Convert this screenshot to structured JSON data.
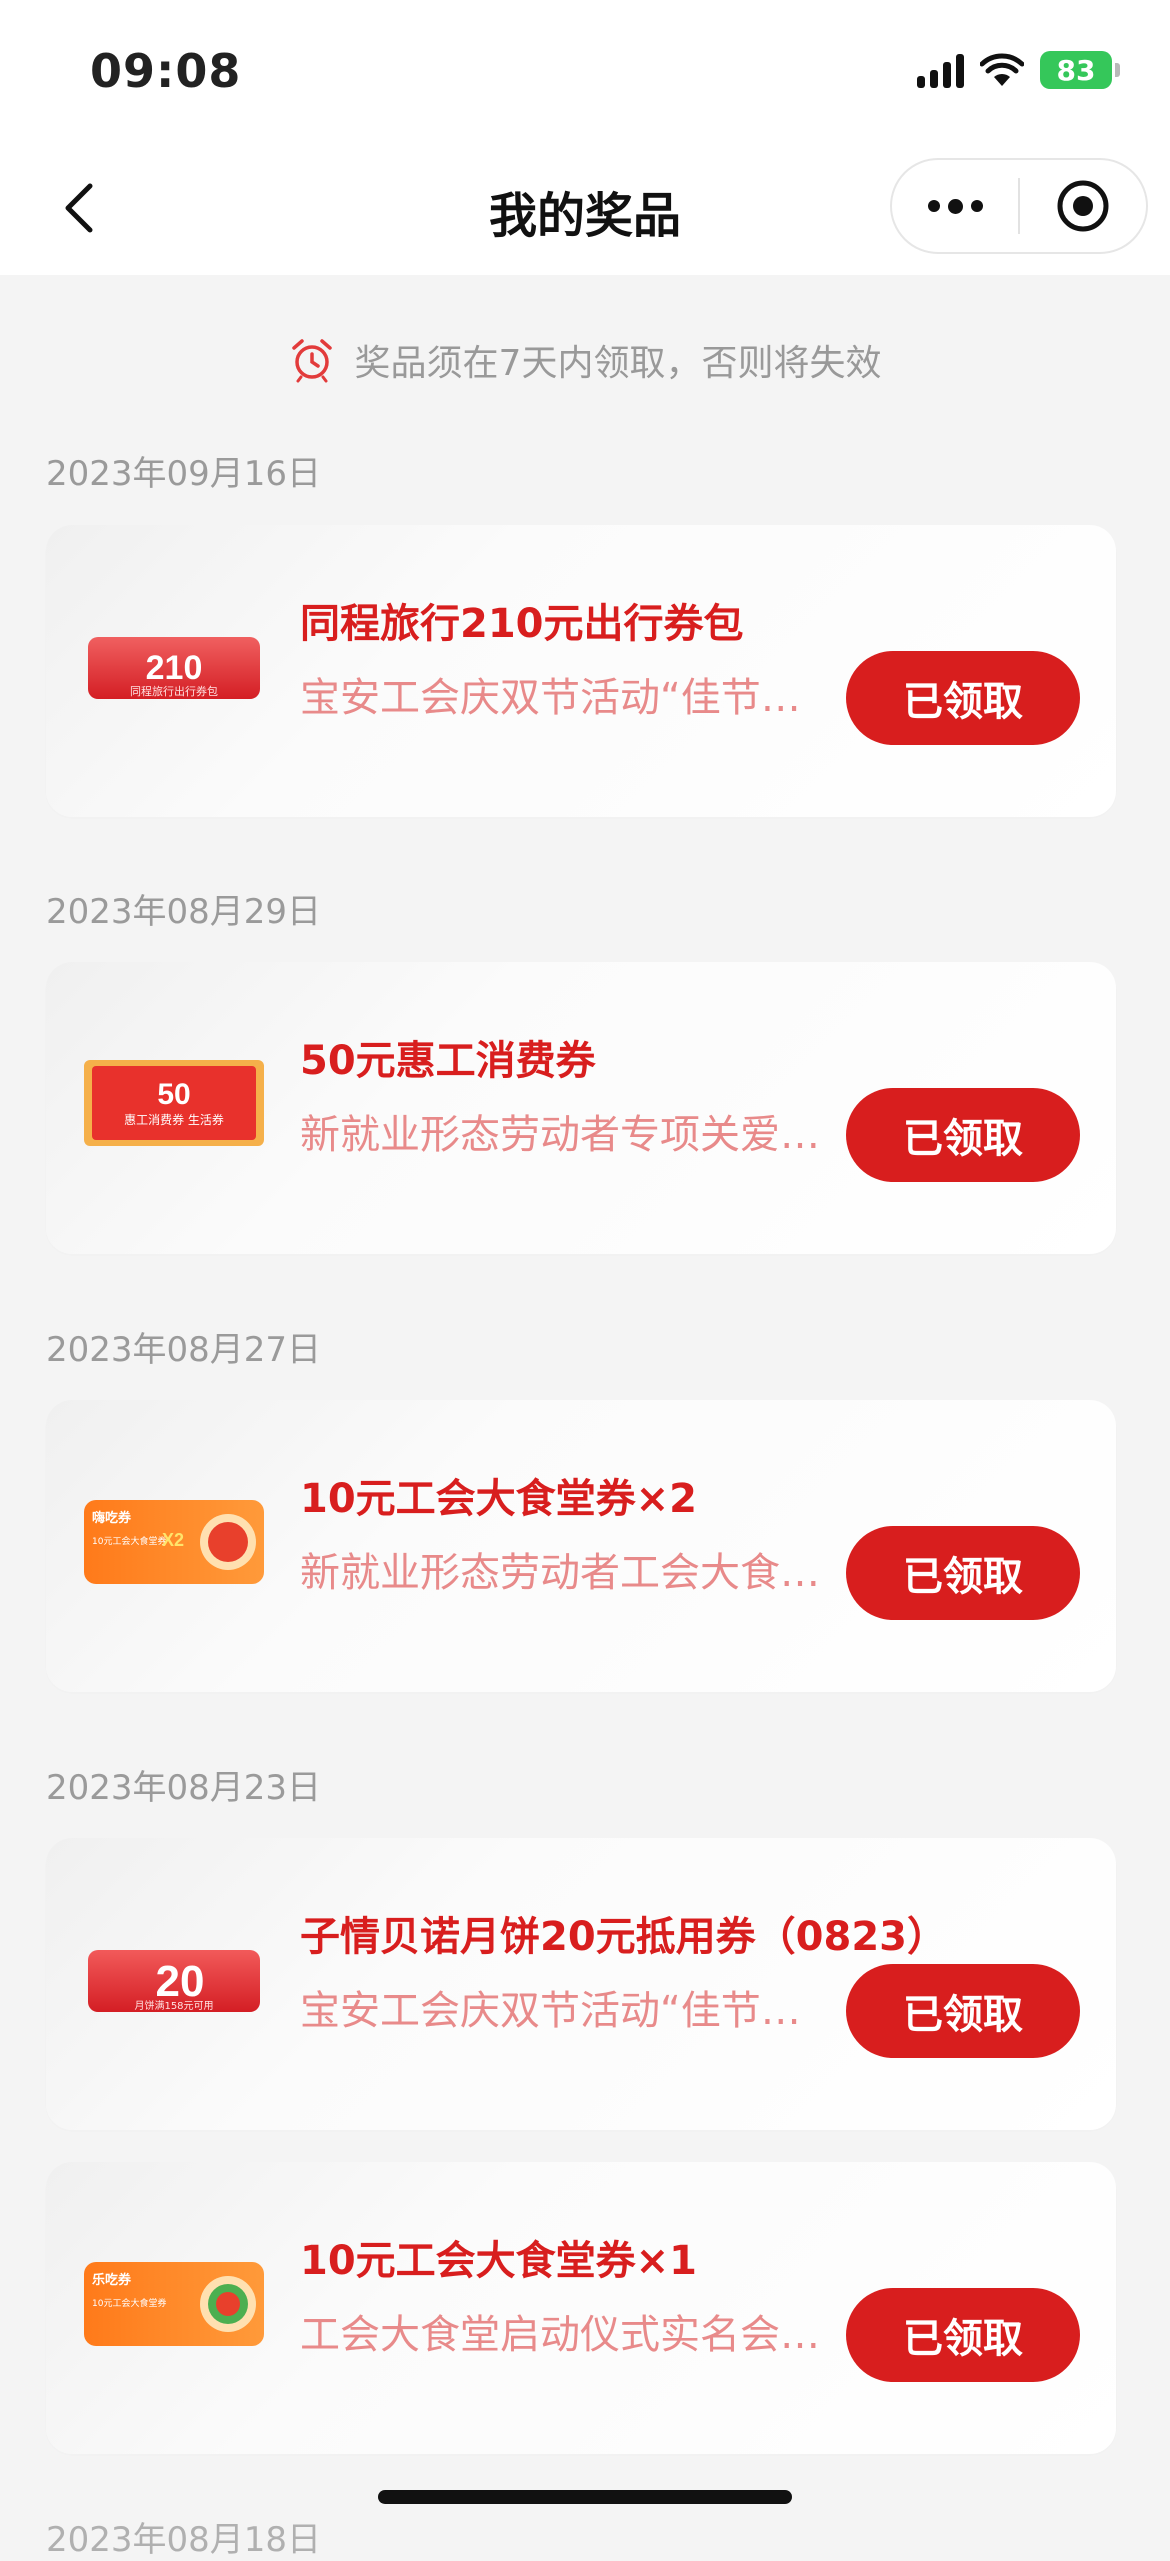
{
  "status_bar": {
    "time": "09:08",
    "battery": "83"
  },
  "nav": {
    "title": "我的奖品"
  },
  "notice": {
    "text": "奖品须在7天内领取，否则将失效"
  },
  "colors": {
    "accent": "#d81e1e",
    "subtitle": "#e88a8a",
    "background": "#f4f4f4"
  },
  "prizes": [
    {
      "date": "2023年09月16日",
      "title": "同程旅行210元出行券包",
      "subtitle": "宝安工会庆双节活动“佳节迎国庆”",
      "button": "已领取",
      "thumb_amount": "210",
      "thumb_caption": "同程旅行出行券包"
    },
    {
      "date": "2023年08月29日",
      "title": "50元惠工消费券",
      "subtitle": "新就业形态劳动者专项关爱活动",
      "button": "已领取",
      "thumb_amount": "50",
      "thumb_caption": "惠工消费券 生活券"
    },
    {
      "date": "2023年08月27日",
      "title": "10元工会大食堂券×2",
      "subtitle": "新就业形态劳动者工会大食堂活动",
      "button": "已领取",
      "thumb_badge": "嗨吃券",
      "thumb_amount": "X2",
      "thumb_caption": "10元工会大食堂券"
    },
    {
      "date": "2023年08月23日",
      "title": "子情贝诺月饼20元抵用券（0823）",
      "subtitle": "宝安工会庆双节活动“佳节迎国庆”",
      "button": "已领取",
      "thumb_amount": "20",
      "thumb_caption": "月饼满158元可用"
    },
    {
      "date": "",
      "title": "10元工会大食堂券×1",
      "subtitle": "工会大食堂启动仪式实名会员活动",
      "button": "已领取",
      "thumb_badge": "乐吃券",
      "thumb_caption": "10元工会大食堂券"
    }
  ],
  "next_date": "2023年08月18日"
}
